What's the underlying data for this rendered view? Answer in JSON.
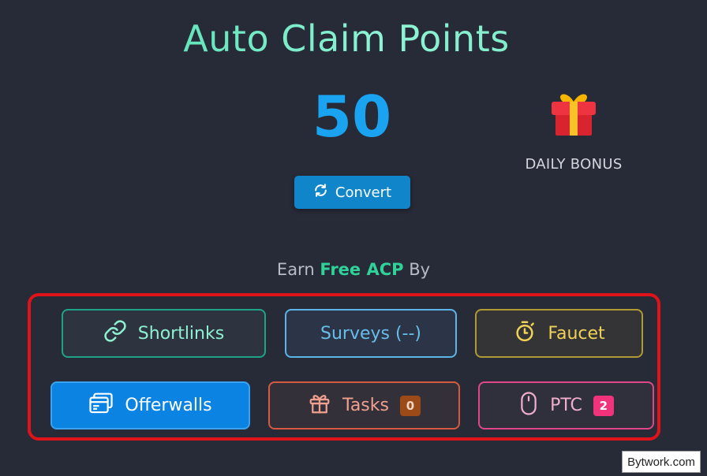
{
  "header": {
    "title": "Auto Claim Points"
  },
  "balance": {
    "points": "50"
  },
  "convert": {
    "label": "Convert",
    "icon": "sync-icon"
  },
  "daily_bonus": {
    "label": "DAILY BONUS",
    "icon": "gift-icon"
  },
  "earn": {
    "prefix": "Earn",
    "highlight": "Free ACP",
    "suffix": "By"
  },
  "buttons": {
    "shortlinks": {
      "label": "Shortlinks",
      "icon": "link-icon"
    },
    "surveys": {
      "label": "Surveys (--)"
    },
    "faucet": {
      "label": "Faucet",
      "icon": "stopwatch-icon"
    },
    "offerwalls": {
      "label": "Offerwalls",
      "icon": "browser-window-icon"
    },
    "tasks": {
      "label": "Tasks",
      "badge": "0",
      "icon": "gift-icon"
    },
    "ptc": {
      "label": "PTC",
      "badge": "2",
      "icon": "mouse-icon"
    }
  },
  "colors": {
    "background": "#272a37",
    "accent_green": "#2fd39a",
    "accent_blue": "#1aa3f0",
    "highlight_frame": "#e0131b"
  },
  "watermark": {
    "text": "Bytwork.com"
  }
}
